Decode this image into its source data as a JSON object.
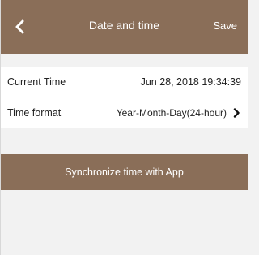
{
  "header": {
    "title": "Date and time",
    "save_label": "Save"
  },
  "rows": [
    {
      "label": "Current Time",
      "value": "Jun 28, 2018 19:34:39"
    },
    {
      "label": "Time format",
      "value": "Year-Month-Day(24-hour)"
    }
  ],
  "sync_button": {
    "label": "Synchronize time with App"
  },
  "colors": {
    "accent": "#8a6e58",
    "background": "#f2f2f2",
    "card": "#ffffff"
  },
  "icons": {
    "back": "chevron-left-icon",
    "row_arrow": "chevron-right-icon"
  }
}
